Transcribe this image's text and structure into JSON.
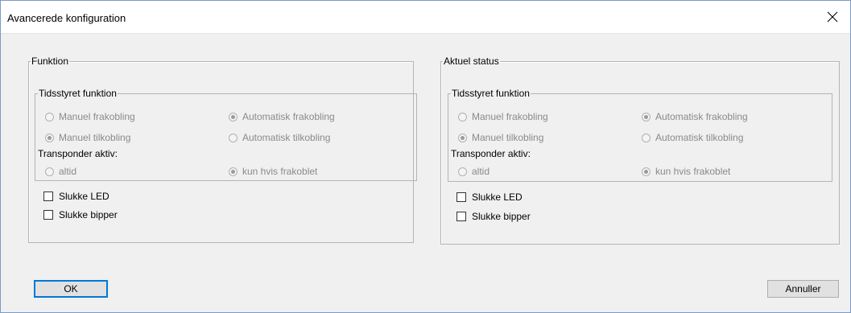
{
  "window": {
    "title": "Avancerede konfiguration",
    "close_glyph": "×"
  },
  "left_panel": {
    "title": "Funktion",
    "timed_group": {
      "title": "Tidsstyret funktion",
      "options": {
        "manual_off": {
          "label": "Manuel frakobling",
          "selected": false
        },
        "auto_off": {
          "label": "Automatisk frakobling",
          "selected": true
        },
        "manual_on": {
          "label": "Manuel tilkobling",
          "selected": true
        },
        "auto_on": {
          "label": "Automatisk tilkobling",
          "selected": false
        }
      },
      "transponder_label": "Transponder aktiv:",
      "transponder_options": {
        "always": {
          "label": "altid",
          "selected": false
        },
        "only_off": {
          "label": "kun hvis frakoblet",
          "selected": true
        }
      }
    },
    "checkboxes": {
      "led": {
        "label": "Slukke LED",
        "checked": false
      },
      "beeper": {
        "label": "Slukke bipper",
        "checked": false
      }
    }
  },
  "right_panel": {
    "title": "Aktuel status",
    "timed_group": {
      "title": "Tidsstyret funktion",
      "options": {
        "manual_off": {
          "label": "Manuel frakobling",
          "selected": false
        },
        "auto_off": {
          "label": "Automatisk frakobling",
          "selected": true
        },
        "manual_on": {
          "label": "Manuel tilkobling",
          "selected": true
        },
        "auto_on": {
          "label": "Automatisk tilkobling",
          "selected": false
        }
      },
      "transponder_label": "Transponder aktiv:",
      "transponder_options": {
        "always": {
          "label": "altid",
          "selected": false
        },
        "only_off": {
          "label": "kun hvis frakoblet",
          "selected": true
        }
      }
    },
    "checkboxes": {
      "led": {
        "label": "Slukke LED",
        "checked": false
      },
      "beeper": {
        "label": "Slukke bipper",
        "checked": false
      }
    }
  },
  "buttons": {
    "ok": "OK",
    "cancel": "Annuller"
  },
  "colors": {
    "accent": "#0078d7",
    "disabled_text": "#8a8a8a",
    "dialog_bg": "#f0f0f0"
  }
}
